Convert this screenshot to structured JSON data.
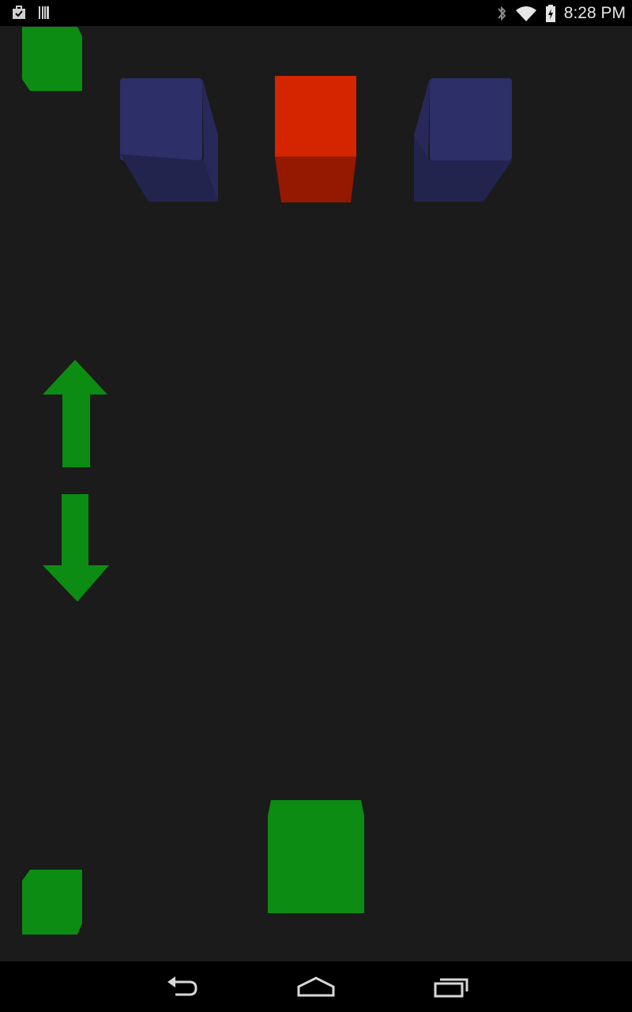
{
  "status_bar": {
    "time": "8:28 PM",
    "left_icons": [
      "briefcase-check-icon",
      "barcode-icon"
    ],
    "right_icons": [
      "bluetooth-icon",
      "wifi-icon",
      "battery-charging-icon"
    ]
  },
  "game": {
    "background_color": "#1b1b1b",
    "colors": {
      "green": "#0c8c12",
      "red_top": "#d42400",
      "red_front": "#951800",
      "blue_top": "#2d2f68",
      "blue_front": "#23244e"
    },
    "objects": [
      "corner-block-top-left",
      "blue-cube-left",
      "red-cube-center",
      "blue-cube-right",
      "up-arrow-button",
      "down-arrow-button",
      "corner-block-bottom-left",
      "green-player-block"
    ]
  },
  "nav_bar": {
    "buttons": [
      "back-icon",
      "home-icon",
      "recent-apps-icon"
    ]
  }
}
